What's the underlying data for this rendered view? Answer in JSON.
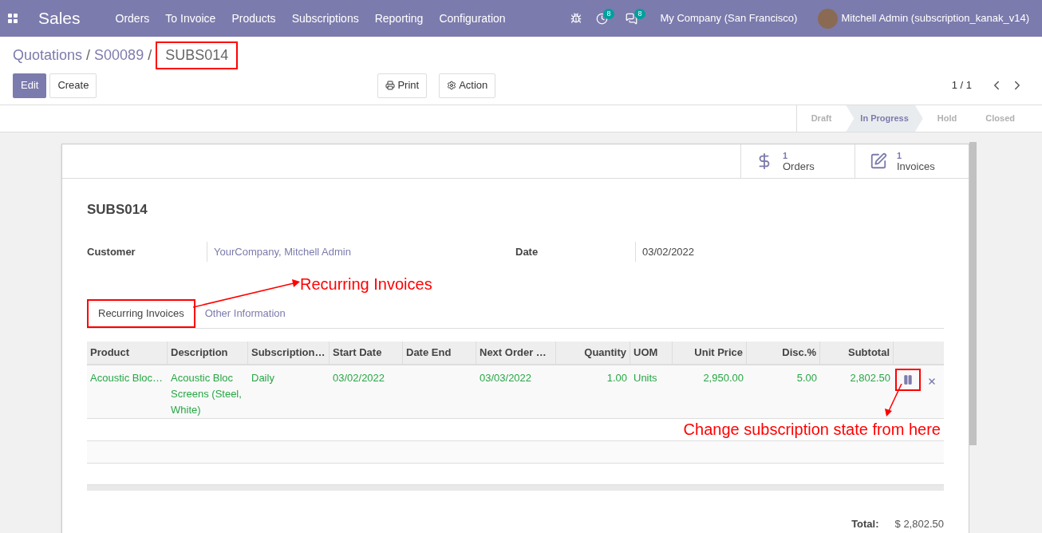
{
  "navbar": {
    "app_title": "Sales",
    "menu": [
      "Orders",
      "To Invoice",
      "Products",
      "Subscriptions",
      "Reporting",
      "Configuration"
    ],
    "activity_count": "8",
    "message_count": "8",
    "company": "My Company (San Francisco)",
    "user": "Mitchell Admin (subscription_kanak_v14)"
  },
  "breadcrumb_separator": "/",
  "breadcrumb": [
    {
      "label": "Quotations",
      "highlighted": false
    },
    {
      "label": "S00089",
      "highlighted": false
    },
    {
      "label": "SUBS014",
      "highlighted": true
    }
  ],
  "buttons": {
    "edit": "Edit",
    "create": "Create",
    "print": "Print",
    "action": "Action"
  },
  "pager": "1 / 1",
  "statusbar": [
    {
      "label": "Draft",
      "selected": false
    },
    {
      "label": "In Progress",
      "selected": true
    },
    {
      "label": "Hold",
      "selected": false
    },
    {
      "label": "Closed",
      "selected": false
    }
  ],
  "stat_buttons": [
    {
      "kind": "orders",
      "count": "1",
      "label": "Orders"
    },
    {
      "kind": "invoices",
      "count": "1",
      "label": "Invoices"
    }
  ],
  "record_title": "SUBS014",
  "fields": [
    {
      "label": "Customer",
      "value": "YourCompany, Mitchell Admin",
      "kind": "link"
    },
    {
      "label": "Date",
      "value": "03/02/2022",
      "kind": "text"
    }
  ],
  "tabs": [
    {
      "label": "Recurring Invoices",
      "selected": true,
      "highlighted": true
    },
    {
      "label": "Other Information",
      "selected": false,
      "highlighted": false
    }
  ],
  "table": {
    "columns": [
      "Product",
      "Description",
      "Subscription…",
      "Start Date",
      "Date End",
      "Next Order …",
      "Quantity",
      "UOM",
      "Unit Price",
      "Disc.%",
      "Subtotal"
    ],
    "rows": [
      {
        "cells": [
          "Acoustic Bloc…",
          "Acoustic Bloc Screens (Steel, White)",
          "Daily",
          "03/02/2022",
          "",
          "03/03/2022",
          "1.00",
          "Units",
          "2,950.00",
          "5.00",
          "2,802.50"
        ],
        "state_button_highlighted": true
      }
    ]
  },
  "total": {
    "label": "Total:",
    "value": "$ 2,802.50"
  },
  "annotations": [
    {
      "kind": "tab",
      "text": "Recurring Invoices"
    },
    {
      "kind": "state",
      "text": "Change subscription state from here"
    }
  ]
}
